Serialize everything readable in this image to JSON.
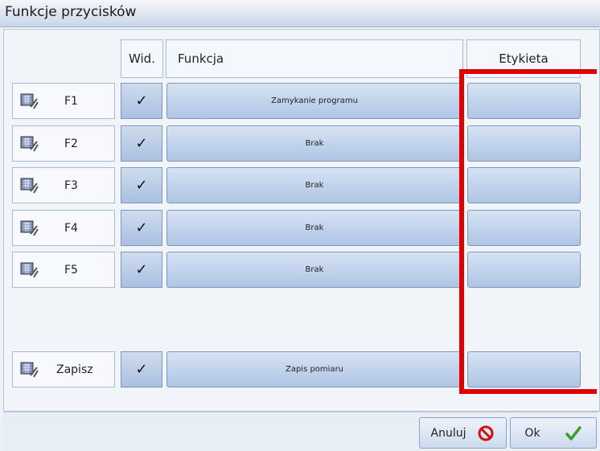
{
  "window": {
    "title": "Funkcje przycisków"
  },
  "header": {
    "wid": "Wid.",
    "funkcja": "Funkcja",
    "etykieta": "Etykieta"
  },
  "rows": [
    {
      "key": "F1",
      "visible_mark": "✓",
      "function": "Zamykanie programu",
      "label": ""
    },
    {
      "key": "F2",
      "visible_mark": "✓",
      "function": "Brak",
      "label": ""
    },
    {
      "key": "F3",
      "visible_mark": "✓",
      "function": "Brak",
      "label": ""
    },
    {
      "key": "F4",
      "visible_mark": "✓",
      "function": "Brak",
      "label": ""
    },
    {
      "key": "F5",
      "visible_mark": "✓",
      "function": "Brak",
      "label": ""
    }
  ],
  "save_row": {
    "key": "Zapisz",
    "visible_mark": "✓",
    "function": "Zapis pomiaru",
    "label": ""
  },
  "footer": {
    "cancel": "Anuluj",
    "ok": "Ok"
  },
  "colors": {
    "highlight": "#e00000",
    "button": "#aec5e5",
    "ok_check": "#3aa02c",
    "cancel_icon": "#d01010"
  },
  "icons": {
    "row": "calculator-tools-icon",
    "cancel": "prohibited-icon",
    "ok": "checkmark-icon"
  }
}
